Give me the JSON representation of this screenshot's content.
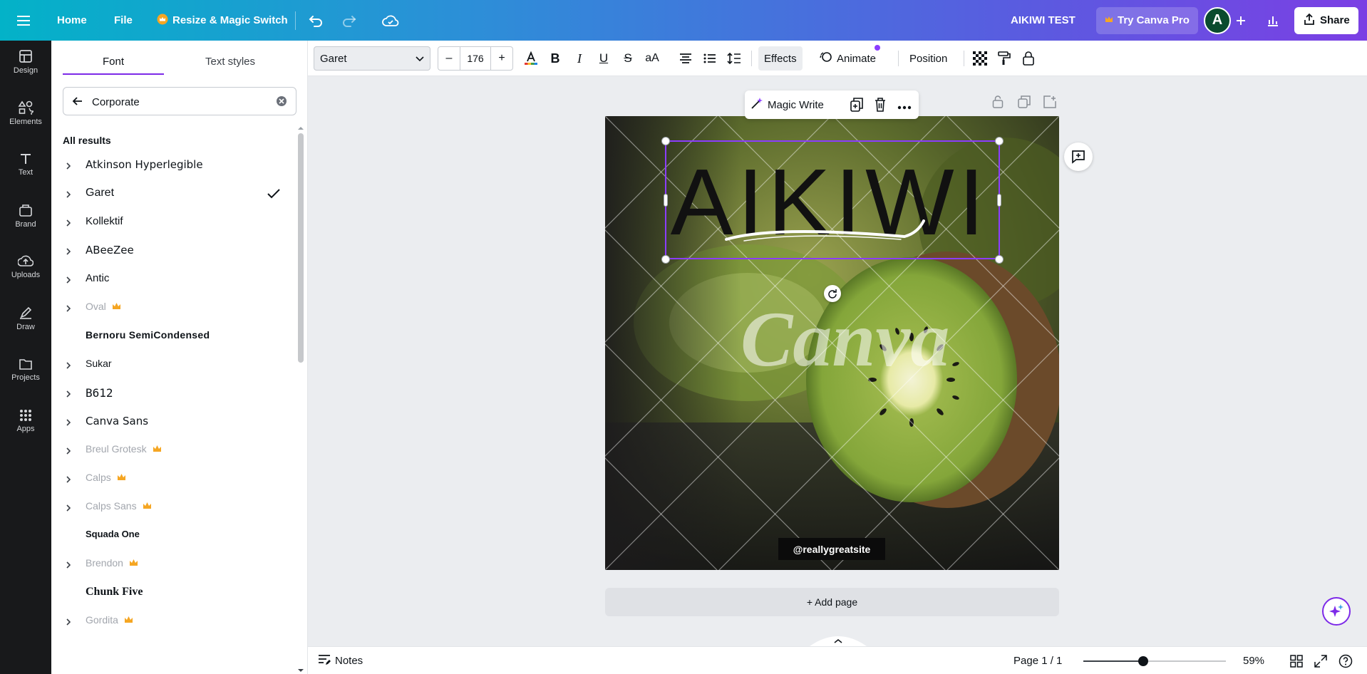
{
  "colors": {
    "brand_gradient_start": "#03b2c8",
    "brand_gradient_end": "#7b3fe4",
    "accent": "#8b3dff",
    "pro_crown": "#f5a623"
  },
  "topbar": {
    "menu_icon": "hamburger-icon",
    "home": "Home",
    "file": "File",
    "resize": "Resize & Magic Switch",
    "undo_icon": "undo-icon",
    "redo_icon": "redo-icon",
    "save_icon": "cloud-check-icon",
    "doc_title": "AIKIWI TEST",
    "try_pro": "Try Canva Pro",
    "avatar_letter": "A",
    "add_icon": "plus-icon",
    "analytics_icon": "bar-chart-icon",
    "share": "Share"
  },
  "rail": [
    {
      "label": "Design",
      "icon": "design-icon"
    },
    {
      "label": "Elements",
      "icon": "elements-icon"
    },
    {
      "label": "Text",
      "icon": "text-icon"
    },
    {
      "label": "Brand",
      "icon": "brand-icon"
    },
    {
      "label": "Uploads",
      "icon": "upload-icon"
    },
    {
      "label": "Draw",
      "icon": "draw-icon"
    },
    {
      "label": "Projects",
      "icon": "folder-icon"
    },
    {
      "label": "Apps",
      "icon": "apps-icon"
    }
  ],
  "panel": {
    "tabs": [
      "Font",
      "Text styles"
    ],
    "search_value": "Corporate",
    "results_title": "All results",
    "fonts": [
      {
        "name": "Atkinson Hyperlegible",
        "expandable": true,
        "pro": false,
        "selected": false
      },
      {
        "name": "Garet",
        "expandable": true,
        "pro": false,
        "selected": true
      },
      {
        "name": "Kollektif",
        "expandable": true,
        "pro": false,
        "selected": false
      },
      {
        "name": "ABeeZee",
        "expandable": true,
        "pro": false,
        "selected": false
      },
      {
        "name": "Antic",
        "expandable": true,
        "pro": false,
        "selected": false
      },
      {
        "name": "Oval",
        "expandable": true,
        "pro": true,
        "selected": false
      },
      {
        "name": "Bernoru SemiCondensed",
        "expandable": false,
        "pro": false,
        "selected": false
      },
      {
        "name": "Sukar",
        "expandable": true,
        "pro": false,
        "selected": false
      },
      {
        "name": "B612",
        "expandable": true,
        "pro": false,
        "selected": false
      },
      {
        "name": "Canva Sans",
        "expandable": true,
        "pro": false,
        "selected": false
      },
      {
        "name": "Breul Grotesk",
        "expandable": true,
        "pro": true,
        "selected": false
      },
      {
        "name": "Calps",
        "expandable": true,
        "pro": true,
        "selected": false
      },
      {
        "name": "Calps Sans",
        "expandable": true,
        "pro": true,
        "selected": false
      },
      {
        "name": "Squada One",
        "expandable": false,
        "pro": false,
        "selected": false
      },
      {
        "name": "Brendon",
        "expandable": true,
        "pro": true,
        "selected": false
      },
      {
        "name": "Chunk Five",
        "expandable": false,
        "pro": false,
        "selected": false
      },
      {
        "name": "Gordita",
        "expandable": true,
        "pro": true,
        "selected": false
      }
    ]
  },
  "toolbar": {
    "font": "Garet",
    "minus": "–",
    "size": "176",
    "plus": "+",
    "effects": "Effects",
    "animate": "Animate",
    "position": "Position"
  },
  "canvas": {
    "magic_write": "Magic Write",
    "headline": "AIKIWI",
    "watermark": "Canva",
    "handle_text": "@reallygreatsite",
    "add_page": "+ Add page"
  },
  "bottombar": {
    "notes": "Notes",
    "page": "Page 1 / 1",
    "zoom": "59%",
    "zoom_fraction": 0.59
  }
}
